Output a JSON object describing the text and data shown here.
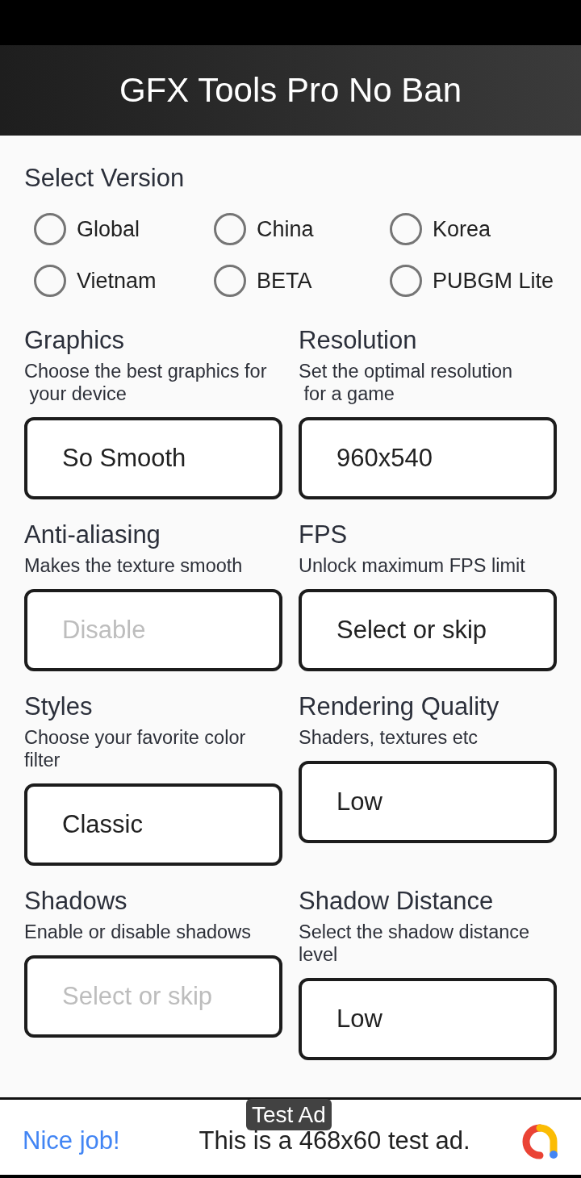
{
  "app_bar": {
    "title": "GFX Tools Pro No Ban"
  },
  "version": {
    "label": "Select Version",
    "options": [
      {
        "label": "Global",
        "selected": false
      },
      {
        "label": "China",
        "selected": false
      },
      {
        "label": "Korea",
        "selected": false
      },
      {
        "label": "Vietnam",
        "selected": false
      },
      {
        "label": "BETA",
        "selected": false
      },
      {
        "label": "PUBGM Lite",
        "selected": false
      }
    ]
  },
  "settings": [
    {
      "title": "Graphics",
      "description": "Choose the best graphics for\n your device",
      "value": "So Smooth"
    },
    {
      "title": "Resolution",
      "description": "Set the optimal resolution\n for a game",
      "value": "960x540"
    },
    {
      "title": "Anti-aliasing",
      "description": "Makes the texture smooth",
      "placeholder": "Disable"
    },
    {
      "title": "FPS",
      "description": "Unlock maximum FPS limit",
      "value": "Select or skip"
    },
    {
      "title": "Styles",
      "description": "Choose your favorite color filter",
      "value": "Classic"
    },
    {
      "title": "Rendering Quality",
      "description": "Shaders, textures etc",
      "value": "Low"
    },
    {
      "title": "Shadows",
      "description": "Enable or disable shadows",
      "placeholder": "Select or skip"
    },
    {
      "title": "Shadow Distance",
      "description": "Select the shadow distance level",
      "value": "Low"
    }
  ],
  "ad_banner": {
    "badge": "Test Ad",
    "headline": "Nice job!",
    "text": "This is a 468x60 test ad."
  }
}
